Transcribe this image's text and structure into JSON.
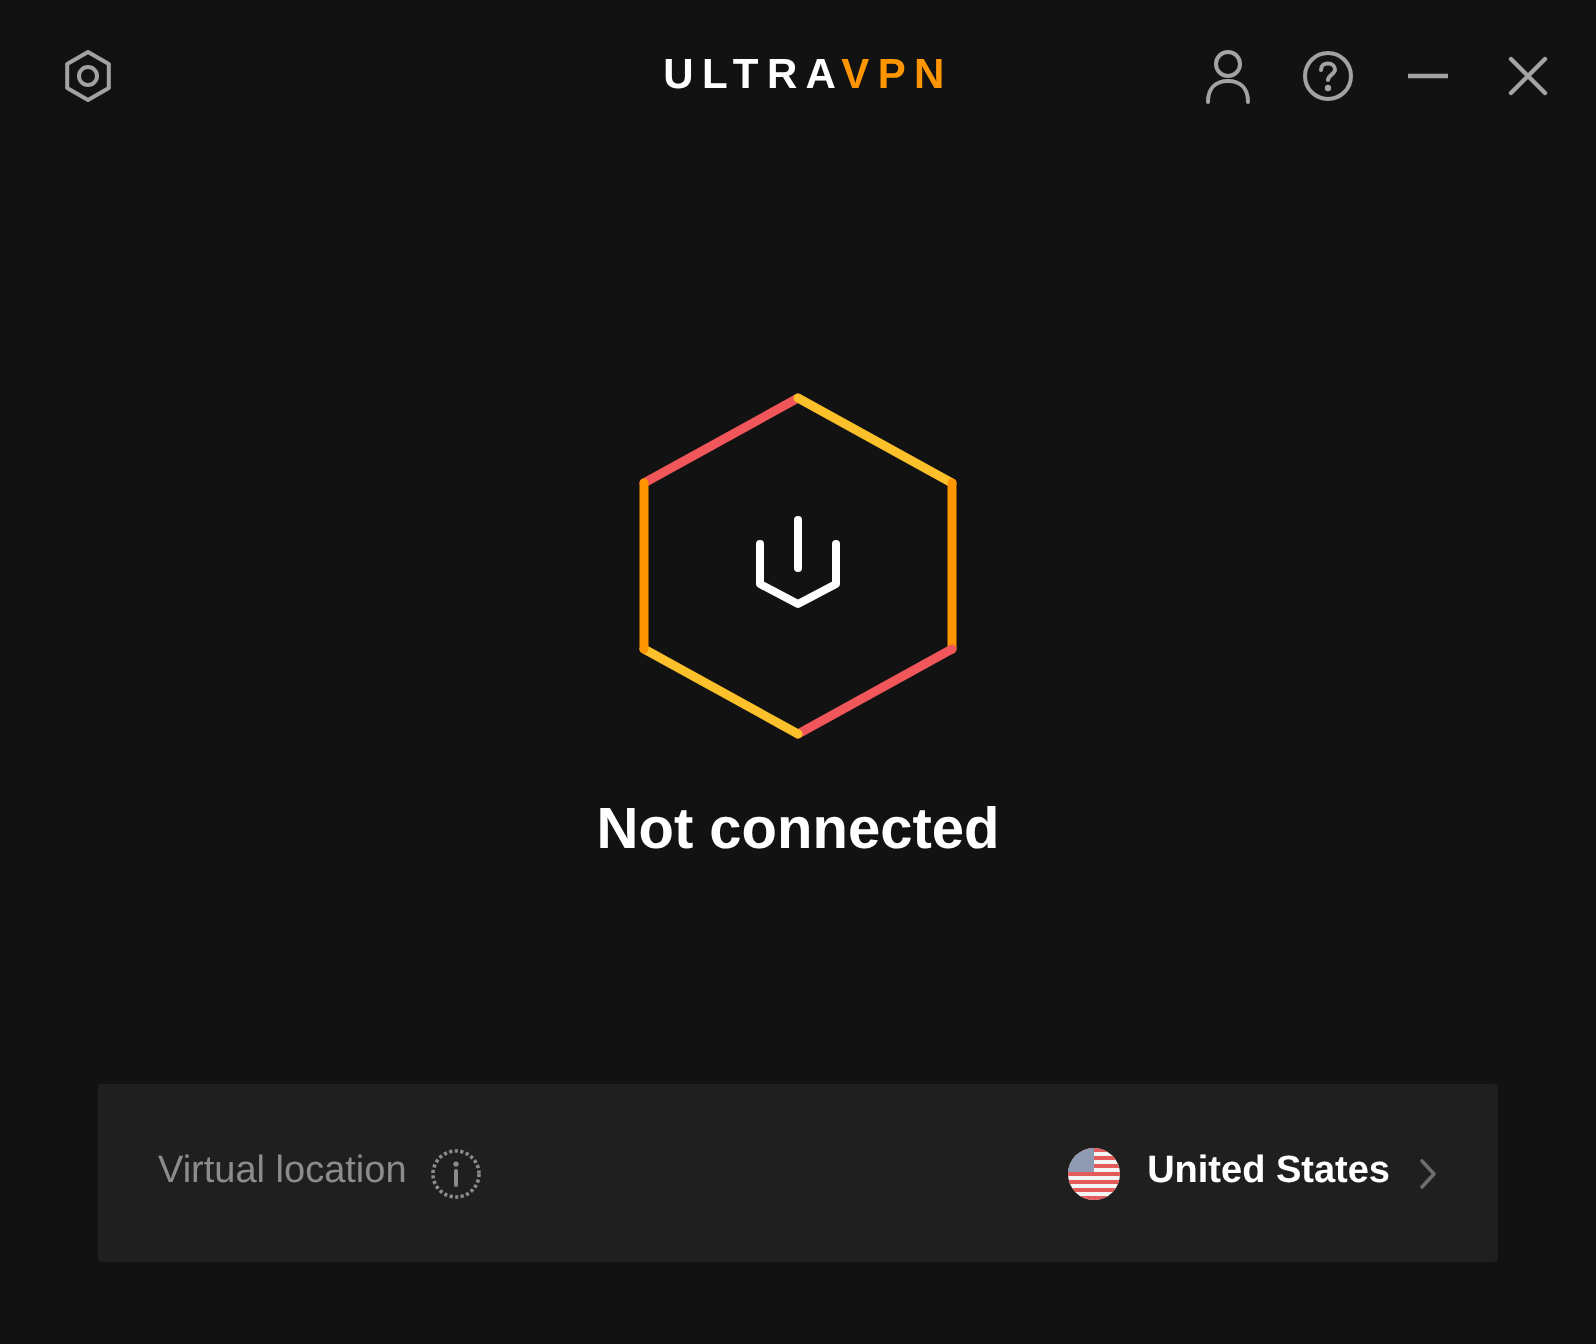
{
  "header": {
    "logo": {
      "primary": "ULTRA",
      "accent": "VPN"
    }
  },
  "status": {
    "connected": false,
    "label": "Not connected"
  },
  "location_bar": {
    "label": "Virtual location",
    "country": "United States"
  }
}
